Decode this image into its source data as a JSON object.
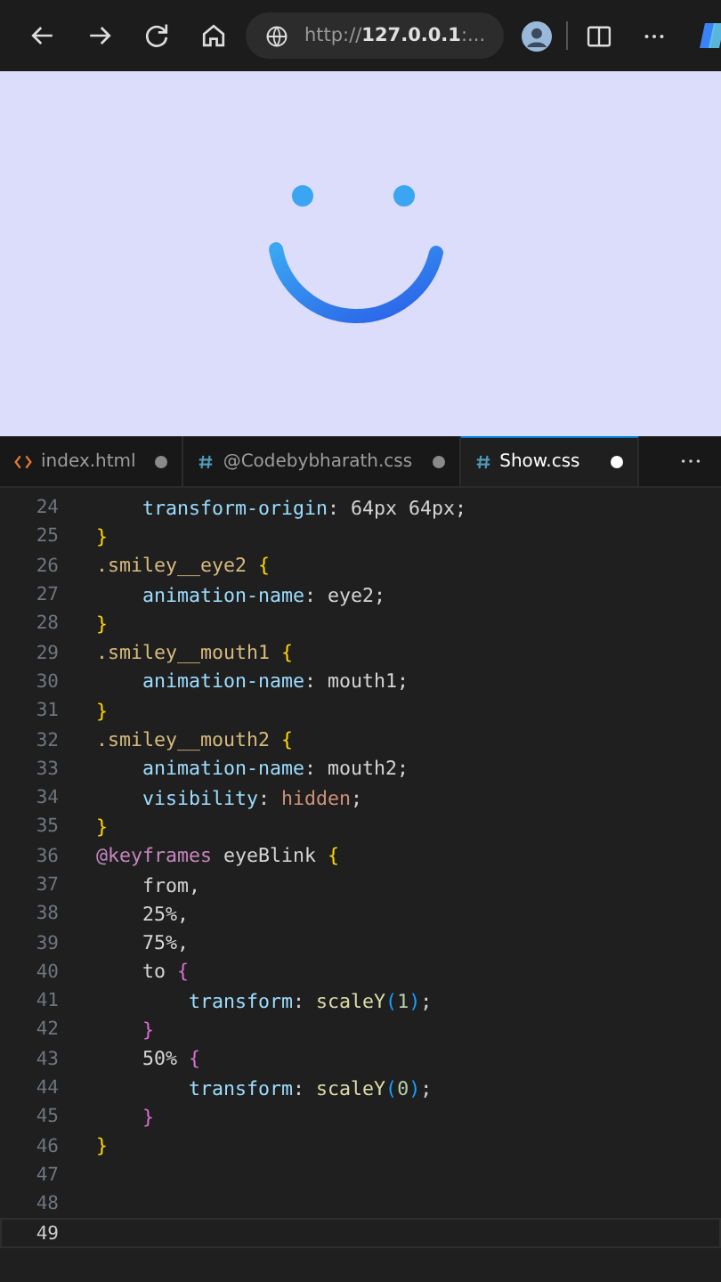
{
  "browser": {
    "url": "http://**127.0.0.1**:..."
  },
  "editor_tabs": [
    {
      "name": "index.html",
      "kind": "html",
      "modified": true,
      "selected": false
    },
    {
      "name": "@Codebybharath.css",
      "kind": "css",
      "modified": true,
      "selected": false
    },
    {
      "name": "Show.css",
      "kind": "css",
      "modified": true,
      "selected": true
    }
  ],
  "code_lines": [
    {
      "number": "24",
      "current": false,
      "tokens": [
        {
          "kind": "prop",
          "text": "    transform-origin"
        },
        {
          "kind": "plain",
          "text": ": 64px 64px;"
        }
      ]
    },
    {
      "number": "25",
      "current": false,
      "tokens": [
        {
          "kind": "brace",
          "text": "}"
        }
      ]
    },
    {
      "number": "26",
      "current": false,
      "tokens": [
        {
          "kind": "selector",
          "text": ".smiley__eye2"
        },
        {
          "kind": "brace",
          "text": " {"
        }
      ]
    },
    {
      "number": "27",
      "current": false,
      "tokens": [
        {
          "kind": "prop",
          "text": "    animation-name"
        },
        {
          "kind": "plain",
          "text": ": eye2;"
        }
      ]
    },
    {
      "number": "28",
      "current": false,
      "tokens": [
        {
          "kind": "brace",
          "text": "}"
        }
      ]
    },
    {
      "number": "29",
      "current": false,
      "tokens": [
        {
          "kind": "selector",
          "text": ".smiley__mouth1"
        },
        {
          "kind": "brace",
          "text": " {"
        }
      ]
    },
    {
      "number": "30",
      "current": false,
      "tokens": [
        {
          "kind": "prop",
          "text": "    animation-name"
        },
        {
          "kind": "plain",
          "text": ": mouth1;"
        }
      ]
    },
    {
      "number": "31",
      "current": false,
      "tokens": [
        {
          "kind": "brace",
          "text": "}"
        }
      ]
    },
    {
      "number": "32",
      "current": false,
      "tokens": [
        {
          "kind": "selector",
          "text": ".smiley__mouth2"
        },
        {
          "kind": "brace",
          "text": " {"
        }
      ]
    },
    {
      "number": "33",
      "current": false,
      "tokens": [
        {
          "kind": "prop",
          "text": "    animation-name"
        },
        {
          "kind": "plain",
          "text": ": mouth2;"
        }
      ]
    },
    {
      "number": "34",
      "current": false,
      "tokens": [
        {
          "kind": "prop",
          "text": "    visibility"
        },
        {
          "kind": "plain",
          "text": ": "
        },
        {
          "kind": "string",
          "text": "hidden"
        },
        {
          "kind": "plain",
          "text": ";"
        }
      ]
    },
    {
      "number": "35",
      "current": false,
      "tokens": [
        {
          "kind": "brace",
          "text": "}"
        }
      ]
    },
    {
      "number": "36",
      "current": false,
      "tokens": [
        {
          "kind": "keyword",
          "text": "@keyframes"
        },
        {
          "kind": "plain",
          "text": " eyeBlink"
        },
        {
          "kind": "brace",
          "text": " {"
        }
      ]
    },
    {
      "number": "37",
      "current": false,
      "tokens": [
        {
          "kind": "plain",
          "text": "    from,"
        }
      ]
    },
    {
      "number": "38",
      "current": false,
      "tokens": [
        {
          "kind": "plain",
          "text": "    25%,"
        }
      ]
    },
    {
      "number": "39",
      "current": false,
      "tokens": [
        {
          "kind": "plain",
          "text": "    75%,"
        }
      ]
    },
    {
      "number": "40",
      "current": false,
      "tokens": [
        {
          "kind": "plain",
          "text": "    to"
        },
        {
          "kind": "brace2",
          "text": " {"
        }
      ]
    },
    {
      "number": "41",
      "current": false,
      "tokens": [
        {
          "kind": "prop",
          "text": "        transform"
        },
        {
          "kind": "plain",
          "text": ": "
        },
        {
          "kind": "func",
          "text": "scaleY"
        },
        {
          "kind": "paren",
          "text": "("
        },
        {
          "kind": "number",
          "text": "1"
        },
        {
          "kind": "paren",
          "text": ")"
        },
        {
          "kind": "plain",
          "text": ";"
        }
      ]
    },
    {
      "number": "42",
      "current": false,
      "tokens": [
        {
          "kind": "brace2",
          "text": "    }"
        }
      ]
    },
    {
      "number": "43",
      "current": false,
      "tokens": [
        {
          "kind": "plain",
          "text": "    50%"
        },
        {
          "kind": "brace2",
          "text": " {"
        }
      ]
    },
    {
      "number": "44",
      "current": false,
      "tokens": [
        {
          "kind": "prop",
          "text": "        transform"
        },
        {
          "kind": "plain",
          "text": ": "
        },
        {
          "kind": "func",
          "text": "scaleY"
        },
        {
          "kind": "paren",
          "text": "("
        },
        {
          "kind": "number",
          "text": "0"
        },
        {
          "kind": "paren",
          "text": ")"
        },
        {
          "kind": "plain",
          "text": ";"
        }
      ]
    },
    {
      "number": "45",
      "current": false,
      "tokens": [
        {
          "kind": "brace2",
          "text": "    }"
        }
      ]
    },
    {
      "number": "46",
      "current": false,
      "tokens": [
        {
          "kind": "brace",
          "text": "}"
        }
      ]
    },
    {
      "number": "47",
      "current": false
    },
    {
      "number": "48",
      "current": false
    },
    {
      "number": "49",
      "current": true
    }
  ]
}
